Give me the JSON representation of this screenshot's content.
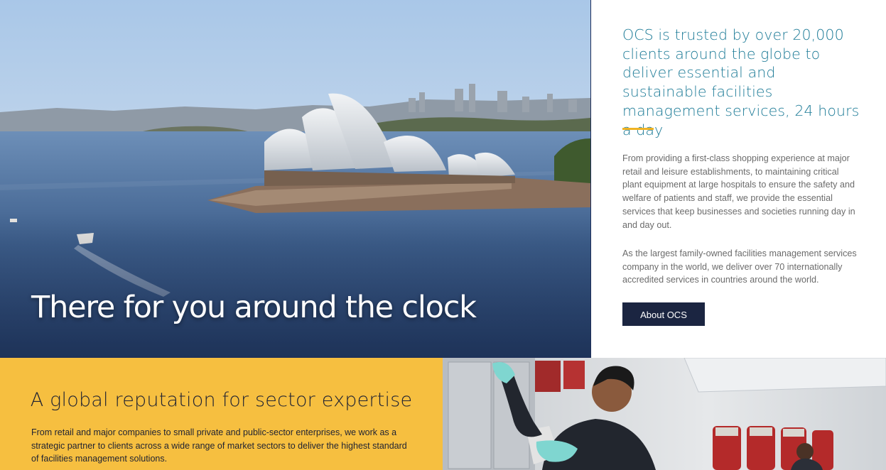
{
  "hero": {
    "title": "There for you around the clock",
    "image": "sydney-opera-house-photo"
  },
  "intro": {
    "heading": "OCS is trusted by over 20,000 clients around the globe to deliver essential and sustainable facilities management services, 24 hours a day",
    "paragraph_1": "From providing a first-class shopping experience at major retail and leisure establishments, to maintaining critical plant equipment at large hospitals to ensure the safety and welfare of patients and staff, we provide the essential services that keep businesses and societies running day in and day out.",
    "paragraph_2": "As the largest family-owned facilities management services company in the world, we deliver over 70 internationally accredited services in countries around the world.",
    "button_label": "About OCS"
  },
  "sector": {
    "title": "A global reputation for sector expertise",
    "paragraph": "From retail and major companies to small private and public-sector enterprises, we work as a strategic partner to clients across a wide range of market sectors to deliver the highest standard of facilities management solutions."
  },
  "cabin": {
    "image": "aircraft-cabin-cleaning-photo"
  },
  "colors": {
    "accent_blue": "#1d7b97",
    "accent_yellow": "#f0b323",
    "band_yellow": "#f6bf40",
    "button_navy": "#1b2541",
    "body_grey": "#6b6b6b"
  }
}
